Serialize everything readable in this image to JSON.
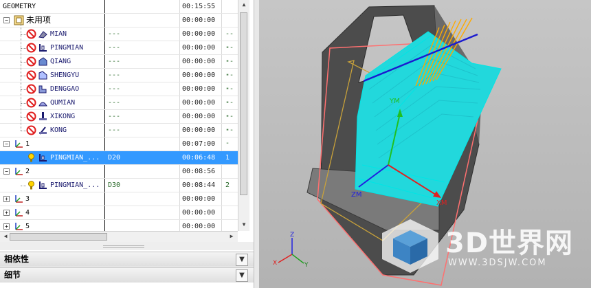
{
  "navigator": {
    "header": {
      "name": "GEOMETRY",
      "time": "00:15:55"
    },
    "unused_group": {
      "name": "未用项",
      "time": "00:00:00"
    },
    "unused_ops": [
      {
        "name": "MIAN",
        "method": "---",
        "time": "00:00:00",
        "extra": "---",
        "icon": "face-mill-icon"
      },
      {
        "name": "PINGMIAN",
        "method": "---",
        "time": "00:00:00",
        "extra": "---",
        "icon": "planar-mill-icon"
      },
      {
        "name": "QIANG",
        "method": "---",
        "time": "00:00:00",
        "extra": "---",
        "icon": "wall-mill-icon"
      },
      {
        "name": "SHENGYU",
        "method": "---",
        "time": "00:00:00",
        "extra": "---",
        "icon": "rest-mill-icon"
      },
      {
        "name": "DENGGAO",
        "method": "---",
        "time": "00:00:00",
        "extra": "---",
        "icon": "zlevel-icon"
      },
      {
        "name": "QUMIAN",
        "method": "---",
        "time": "00:00:00",
        "extra": "---",
        "icon": "contour-surface-icon"
      },
      {
        "name": "XIKONG",
        "method": "---",
        "time": "00:00:00",
        "extra": "---",
        "icon": "drill-icon"
      },
      {
        "name": "KONG",
        "method": "---",
        "time": "00:00:00",
        "extra": "---",
        "icon": "hole-icon"
      }
    ],
    "groups": [
      {
        "name": "1",
        "time": "00:07:00",
        "op": {
          "name": "PINGMIAN_...",
          "tool": "D20",
          "time": "00:06:48",
          "extra": "1"
        }
      },
      {
        "name": "2",
        "time": "00:08:56",
        "op": {
          "name": "PINGMIAN_...",
          "tool": "D30",
          "time": "00:08:44",
          "extra": "2"
        }
      },
      {
        "name": "3",
        "time": "00:00:00"
      },
      {
        "name": "4",
        "time": "00:00:00"
      },
      {
        "name": "5",
        "time": "00:00:00"
      }
    ]
  },
  "panels": {
    "dependencies": "相依性",
    "details": "细节"
  },
  "viewport": {
    "axis_labels": {
      "ym": "YM",
      "zm": "ZM",
      "xm": "XM"
    },
    "triad_labels": {
      "z": "Z",
      "x": "X",
      "y": "Y"
    },
    "watermark": {
      "brand": "3D世界网",
      "url": "WWW.3DSJW.COM"
    },
    "colors": {
      "toolpath": "#00e5e5",
      "retract": "#ffaa00",
      "part": "#4a4a4a",
      "boundary": "#ff7070",
      "selection": "#3399ff"
    }
  }
}
